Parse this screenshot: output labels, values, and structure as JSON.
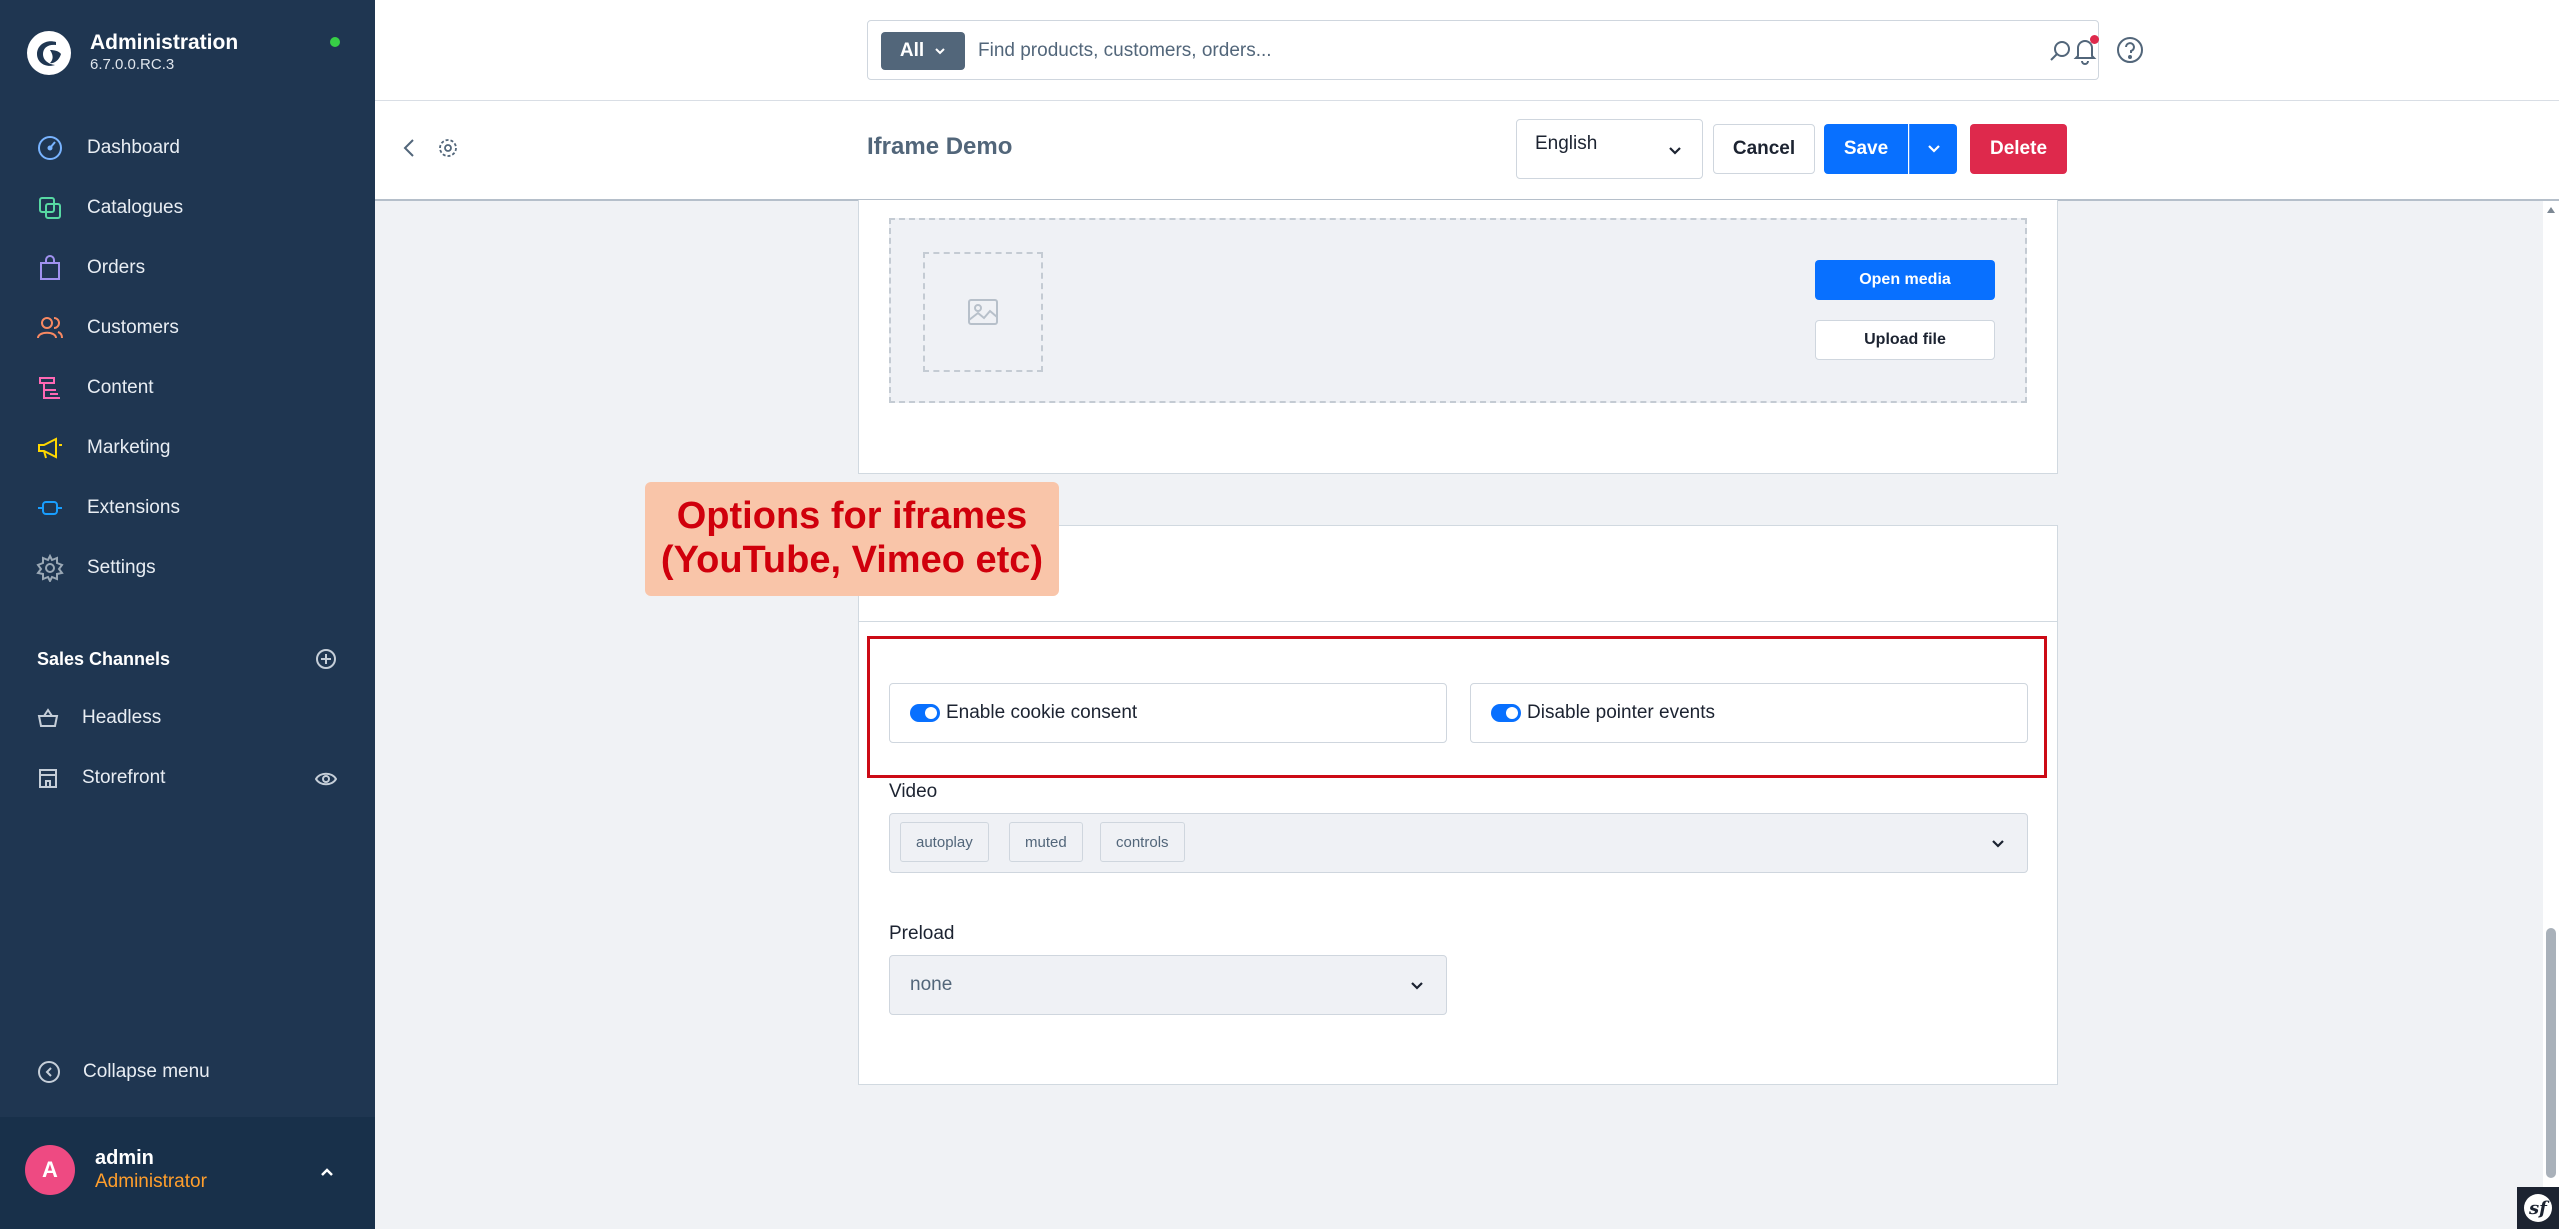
{
  "app": {
    "title": "Administration",
    "version": "6.7.0.0.RC.3"
  },
  "sidebar": {
    "items": [
      {
        "label": "Dashboard",
        "icon": "dashboard-icon",
        "color": "#79b4ff"
      },
      {
        "label": "Catalogues",
        "icon": "catalogue-icon",
        "color": "#57d9a3"
      },
      {
        "label": "Orders",
        "icon": "orders-icon",
        "color": "#a092f0"
      },
      {
        "label": "Customers",
        "icon": "customers-icon",
        "color": "#f88962"
      },
      {
        "label": "Content",
        "icon": "content-icon",
        "color": "#ff68b4"
      },
      {
        "label": "Marketing",
        "icon": "marketing-icon",
        "color": "#ffd700"
      },
      {
        "label": "Extensions",
        "icon": "extensions-icon",
        "color": "#189eff"
      },
      {
        "label": "Settings",
        "icon": "settings-icon",
        "color": "#9aa8b5"
      }
    ],
    "sales_channels_title": "Sales Channels",
    "sales_channels": [
      {
        "label": "Headless",
        "icon": "basket-icon"
      },
      {
        "label": "Storefront",
        "icon": "storefront-icon"
      }
    ],
    "collapse_label": "Collapse menu"
  },
  "user": {
    "initial": "A",
    "name": "admin",
    "role": "Administrator"
  },
  "search": {
    "scope": "All",
    "placeholder": "Find products, customers, orders..."
  },
  "smartbar": {
    "title": "Iframe Demo",
    "language": "English",
    "cancel_label": "Cancel",
    "save_label": "Save",
    "delete_label": "Delete"
  },
  "media": {
    "open_label": "Open media",
    "upload_label": "Upload file"
  },
  "annotation": {
    "line1": "Options for iframes",
    "line2": "(YouTube, Vimeo etc)"
  },
  "options": {
    "cookie_consent_label": "Enable cookie consent",
    "cookie_consent_on": true,
    "pointer_events_label": "Disable pointer events",
    "pointer_events_on": true,
    "video_label": "Video",
    "video_tags": [
      "autoplay",
      "muted",
      "controls"
    ],
    "preload_label": "Preload",
    "preload_value": "none"
  },
  "colors": {
    "sidebar_bg": "#1f3651",
    "primary": "#0870ff",
    "danger": "#de294c",
    "annotation_bg": "#f9c5a9",
    "annotation_text": "#d0000c",
    "highlight_border": "#cc0a16",
    "role_text": "#ff9e2c"
  }
}
